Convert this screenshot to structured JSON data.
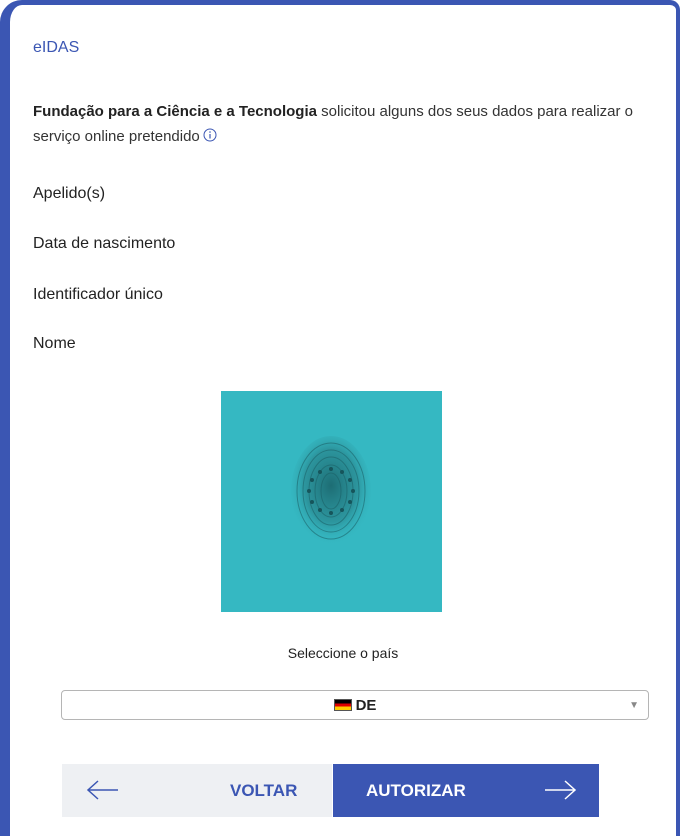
{
  "header": {
    "title": "eIDAS"
  },
  "intro": {
    "org": "Fundação para a Ciência e a Tecnologia",
    "text": " solicitou alguns dos seus dados para realizar o serviço online pretendido"
  },
  "attributes": [
    "Apelido(s)",
    "Data de nascimento",
    "Identificador único",
    "Nome"
  ],
  "country": {
    "label": "Seleccione o país",
    "selected": "DE",
    "flag_icon": "germany-flag-icon"
  },
  "buttons": {
    "back_label": "VOLTAR",
    "authorize_label": "AUTORIZAR"
  },
  "colors": {
    "accent": "#3b56b3",
    "image_bg": "#35b8c2",
    "back_bg": "#eef0f3"
  }
}
